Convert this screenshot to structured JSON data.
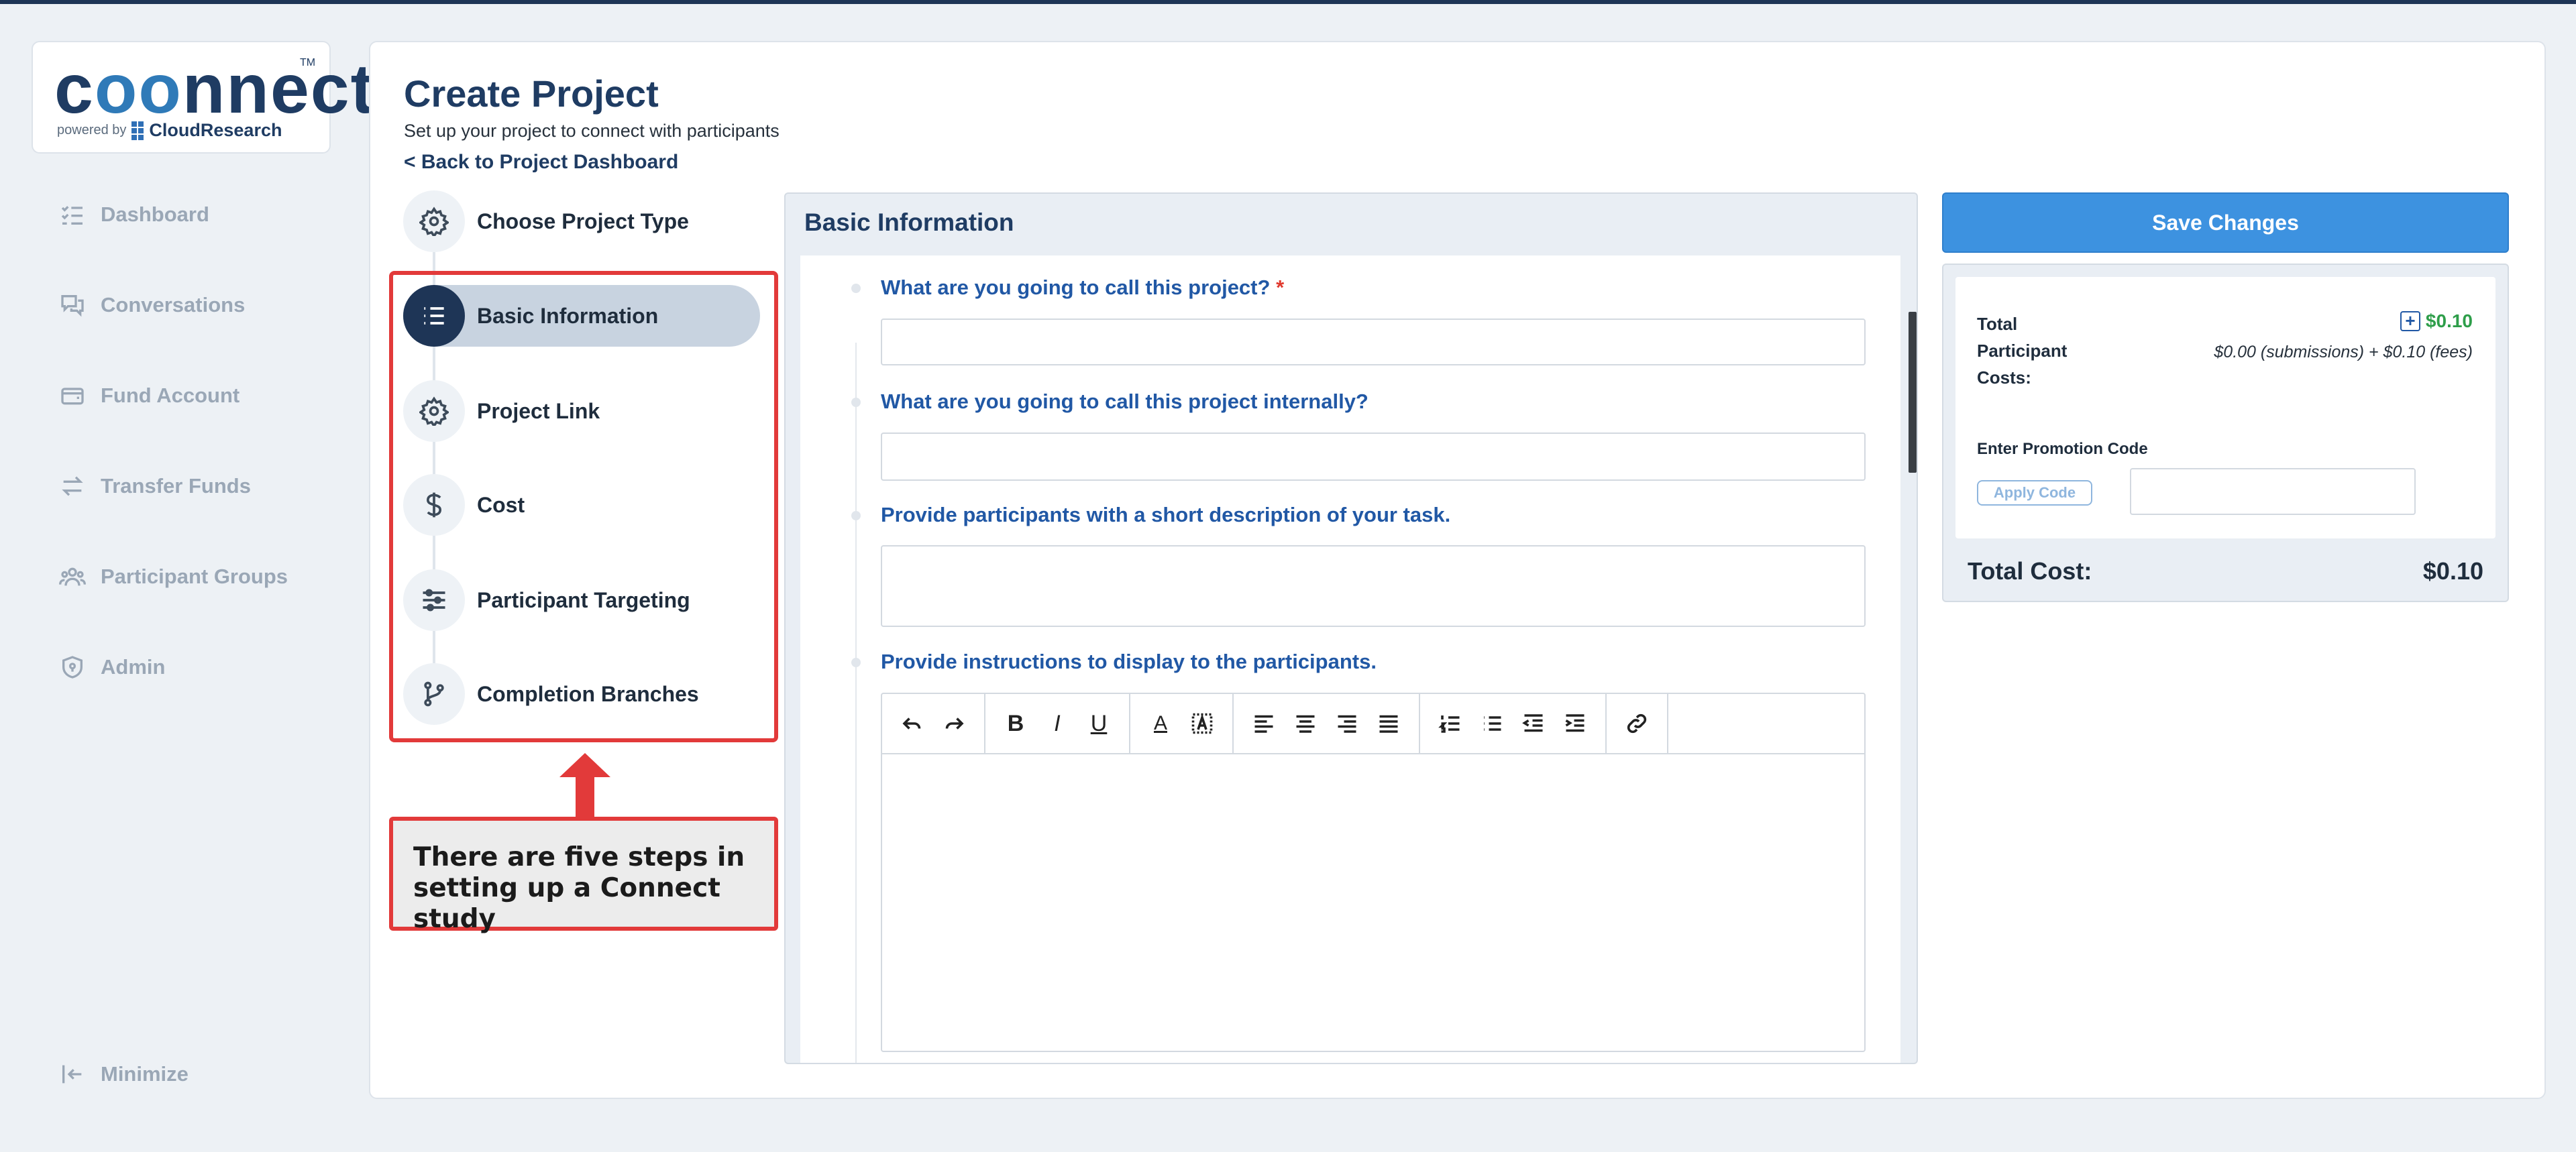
{
  "brand": {
    "logo_text": "connect",
    "trademark": "TM",
    "powered_by": "powered by",
    "company": "CloudResearch"
  },
  "nav": {
    "items": [
      {
        "label": "Dashboard",
        "icon": "list-check-icon"
      },
      {
        "label": "Conversations",
        "icon": "chat-bubbles-icon"
      },
      {
        "label": "Fund Account",
        "icon": "wallet-icon"
      },
      {
        "label": "Transfer Funds",
        "icon": "transfer-arrows-icon"
      },
      {
        "label": "Participant Groups",
        "icon": "users-icon"
      },
      {
        "label": "Admin",
        "icon": "shield-icon"
      }
    ],
    "minimize": "Minimize"
  },
  "header": {
    "title": "Create Project",
    "subtitle": "Set up your project to connect with participants",
    "back_link": "<  Back to Project Dashboard"
  },
  "steps": [
    {
      "label": "Choose Project Type",
      "icon": "gear-icon",
      "active": false
    },
    {
      "label": "Basic Information",
      "icon": "list-icon",
      "active": true
    },
    {
      "label": "Project Link",
      "icon": "gear-icon",
      "active": false
    },
    {
      "label": "Cost",
      "icon": "dollar-icon",
      "active": false
    },
    {
      "label": "Participant Targeting",
      "icon": "sliders-icon",
      "active": false
    },
    {
      "label": "Completion Branches",
      "icon": "branch-icon",
      "active": false
    }
  ],
  "annotation": {
    "callout": "There are five steps in setting up a Connect study",
    "border_color": "#e23a3a"
  },
  "form": {
    "heading": "Basic Information",
    "questions": [
      {
        "label": "What are you going to call this project?",
        "required_mark": "*",
        "value": ""
      },
      {
        "label": "What are you going to call this project internally?",
        "required_mark": "",
        "value": ""
      },
      {
        "label": "Provide participants with a short description of your task.",
        "required_mark": "",
        "value": ""
      },
      {
        "label": "Provide instructions to display to the participants.",
        "required_mark": "",
        "value": ""
      }
    ],
    "toolbar": {
      "groups": [
        [
          "undo-icon",
          "redo-icon"
        ],
        [
          "bold-icon",
          "italic-icon",
          "underline-icon"
        ],
        [
          "font-color-icon",
          "highlight-icon"
        ],
        [
          "align-left-icon",
          "align-center-icon",
          "align-right-icon",
          "align-justify-icon"
        ],
        [
          "ordered-list-icon",
          "bullet-list-icon",
          "outdent-icon",
          "indent-icon"
        ],
        [
          "link-icon"
        ]
      ],
      "glyphs": {
        "bold": "B",
        "italic": "I",
        "underline": "U",
        "font_color": "A"
      }
    }
  },
  "sidebar": {
    "save_button": "Save Changes",
    "total_participant_costs_label": "Total Participant Costs:",
    "total_participant_costs_value": "$0.10",
    "costs_breakdown": "$0.00 (submissions) + $0.10 (fees)",
    "promo_label": "Enter Promotion Code",
    "apply_button": "Apply Code",
    "promo_value": "",
    "total_cost_label": "Total Cost:",
    "total_cost_value": "$0.10"
  },
  "colors": {
    "accent": "#3d92e0",
    "brand_navy": "#1f3c63",
    "green": "#2e9e4a",
    "question_blue": "#2158a5"
  }
}
